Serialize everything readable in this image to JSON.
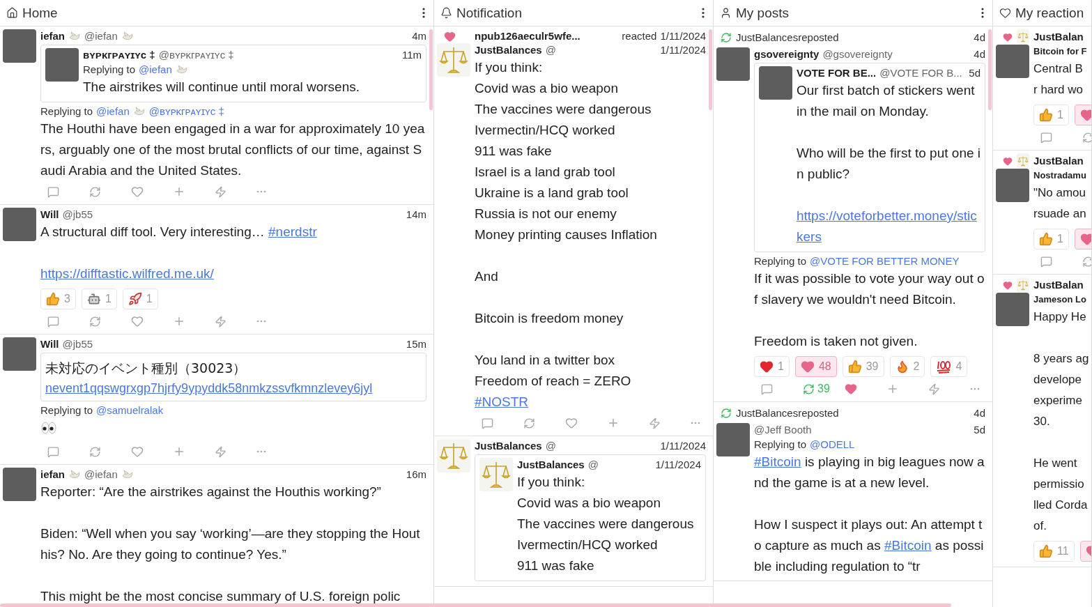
{
  "columns": [
    {
      "title": "Home",
      "kind": "home",
      "cut_off": false,
      "items": [
        {
          "post": {
            "avatar": {
              "kind": "photo"
            },
            "author": {
              "name": "iefan",
              "name_badge": true,
              "handle": "@iefan",
              "handle_badge": true
            },
            "time": "4m",
            "quote": {
              "avatar": {
                "kind": "photo"
              },
              "author": {
                "name": "ʙʏᴘᴋᴦᴘᴀʏɪʏᴄ ‡",
                "handle": "@ʙʏᴘᴋᴦᴘᴀʏɪʏᴄ ‡"
              },
              "time": "11m",
              "replying_to": {
                "label": "Replying to",
                "mentions": [
                  {
                    "text": "@iefan",
                    "badge": true
                  }
                ]
              },
              "body": [
                [
                  {
                    "kind": "text",
                    "text": "The airstrikes will continue until moral worsens."
                  }
                ]
              ]
            },
            "replying_to": {
              "label": "Replying to",
              "mentions": [
                {
                  "text": "@iefan",
                  "badge": true
                },
                {
                  "text": "@ʙʏᴘᴋᴦᴘᴀʏɪʏᴄ ‡"
                }
              ]
            },
            "body": [
              [
                {
                  "kind": "text",
                  "text": "The Houthi have been engaged in a war for approximately 10 years, arguably one of the most brutal conflicts of our time, against Saudi Arabia and the United States."
                }
              ]
            ],
            "actions": {
              "reposted": false,
              "liked": false
            }
          }
        },
        {
          "post": {
            "avatar": {
              "kind": "photo"
            },
            "author": {
              "name": "Will",
              "handle": "@jb55"
            },
            "time": "14m",
            "body": [
              [
                {
                  "kind": "mixed",
                  "parts": [
                    {
                      "kind": "text",
                      "text": "A structural diff tool. Very interesting… "
                    },
                    {
                      "kind": "link",
                      "text": "#nerdstr"
                    }
                  ]
                }
              ],
              [
                {
                  "kind": "link",
                  "text": "https://difftastic.wilfred.me.uk/"
                }
              ]
            ],
            "reactions": [
              {
                "kind": "thumbs_up",
                "count": "3",
                "selected": false
              },
              {
                "kind": "robot",
                "count": "1",
                "selected": false
              },
              {
                "kind": "rocket",
                "count": "1",
                "selected": false
              }
            ],
            "actions": {
              "reposted": false,
              "liked": false
            }
          }
        },
        {
          "post": {
            "avatar": {
              "kind": "photo"
            },
            "author": {
              "name": "Will",
              "handle": "@jb55"
            },
            "time": "15m",
            "embed": {
              "text": "未対応のイベント種別（30023）",
              "link": "nevent1qqswgrxgp7hjrfy9ypyddk58nmkzssvfkmnzlevey6jyl"
            },
            "replying_to": {
              "label": "Replying to",
              "mentions": [
                {
                  "text": "@samuelralak"
                }
              ]
            },
            "body": [
              [
                {
                  "kind": "eyes"
                }
              ]
            ],
            "actions": {
              "reposted": false,
              "liked": false
            }
          }
        },
        {
          "post": {
            "avatar": {
              "kind": "photo"
            },
            "author": {
              "name": "iefan",
              "name_badge": true,
              "handle": "@iefan",
              "handle_badge": true
            },
            "time": "16m",
            "body": [
              [
                {
                  "kind": "text",
                  "text": "Reporter: “Are the airstrikes against the Houthis working?”"
                }
              ],
              [
                {
                  "kind": "text",
                  "text": "Biden: “Well when you say ‘working’—are they stopping the Houthis? No. Are they going to continue? Yes.”"
                }
              ],
              [
                {
                  "kind": "text",
                  "text": "This might be the most concise summary of U.S. foreign polic"
                }
              ]
            ]
          }
        }
      ]
    },
    {
      "title": "Notification",
      "kind": "notification",
      "cut_off": false,
      "items": [
        {
          "header": {
            "kind": "reaction",
            "actor": "npub126aeculr5wfe...",
            "verb": "reacted",
            "time": "1/11/2024"
          },
          "post": {
            "avatar": {
              "kind": "scales"
            },
            "author": {
              "name": "JustBalances",
              "handle": "@"
            },
            "time": "1/11/2024",
            "body": [
              [
                {
                  "kind": "text",
                  "text": "If you think:"
                },
                {
                  "kind": "text",
                  "text": "Covid was a bio weapon"
                },
                {
                  "kind": "text",
                  "text": "The vaccines were dangerous"
                },
                {
                  "kind": "text",
                  "text": "Ivermectin/HCQ worked"
                },
                {
                  "kind": "text",
                  "text": "911 was fake"
                },
                {
                  "kind": "text",
                  "text": "Israel is a land grab tool"
                },
                {
                  "kind": "text",
                  "text": "Ukraine is a land grab tool"
                },
                {
                  "kind": "text",
                  "text": "Russia is not our enemy"
                },
                {
                  "kind": "text",
                  "text": "Money printing causes Inflation"
                }
              ],
              [
                {
                  "kind": "text",
                  "text": "And"
                }
              ],
              [
                {
                  "kind": "text",
                  "text": "Bitcoin is freedom money"
                }
              ],
              [
                {
                  "kind": "text",
                  "text": "You land in a twitter box"
                },
                {
                  "kind": "text",
                  "text": "Freedom of reach = ZERO"
                },
                {
                  "kind": "link",
                  "text": "#NOSTR"
                }
              ]
            ],
            "actions": {
              "reposted": false,
              "liked": false
            }
          }
        },
        {
          "post": {
            "avatar": {
              "kind": "scales"
            },
            "author": {
              "name": "JustBalances",
              "handle": "@"
            },
            "time": "1/11/2024",
            "quote": {
              "avatar": {
                "kind": "scales"
              },
              "author": {
                "name": "JustBalances",
                "handle": "@"
              },
              "time": "1/11/2024",
              "body": [
                [
                  {
                    "kind": "text",
                    "text": "If you think:"
                  },
                  {
                    "kind": "text",
                    "text": "Covid was a bio weapon"
                  },
                  {
                    "kind": "text",
                    "text": "The vaccines were dangerous"
                  },
                  {
                    "kind": "text",
                    "text": "Ivermectin/HCQ worked"
                  },
                  {
                    "kind": "text",
                    "text": "911 was fake"
                  }
                ]
              ]
            }
          }
        }
      ]
    },
    {
      "title": "My posts",
      "kind": "profile",
      "cut_off": false,
      "items": [
        {
          "header": {
            "kind": "repost",
            "text": "JustBalancesreposted",
            "time": "4d"
          },
          "post": {
            "avatar": {
              "kind": "photo"
            },
            "author": {
              "name": "gsovereignty",
              "handle": "@gsovereignty"
            },
            "time": "4d",
            "quote": {
              "avatar": {
                "kind": "photo"
              },
              "author": {
                "name": "VOTE FOR BE...",
                "handle": "@VOTE FOR B..."
              },
              "time": "5d",
              "body": [
                [
                  {
                    "kind": "text",
                    "text": "Our first batch of stickers went in the mail on Monday."
                  }
                ],
                [
                  {
                    "kind": "text",
                    "text": "Who will be the first to put one in public?"
                  }
                ],
                [
                  {
                    "kind": "link",
                    "text": "https://voteforbetter.money/stickers"
                  }
                ]
              ]
            },
            "replying_to": {
              "label": "Replying to",
              "mentions": [
                {
                  "text": "@VOTE FOR BETTER MONEY"
                }
              ]
            },
            "body": [
              [
                {
                  "kind": "text",
                  "text": "If it was possible to vote your way out of slavery we wouldn't need Bitcoin."
                }
              ],
              [
                {
                  "kind": "text",
                  "text": "Freedom is taken not given."
                }
              ]
            ],
            "reactions": [
              {
                "kind": "red_heart",
                "count": "1",
                "selected": false
              },
              {
                "kind": "pink_heart",
                "count": "48",
                "selected": true
              },
              {
                "kind": "thumbs_up",
                "count": "39",
                "selected": false
              },
              {
                "kind": "fire",
                "count": "2",
                "selected": false
              },
              {
                "kind": "hundred",
                "count": "4",
                "selected": false
              }
            ],
            "actions": {
              "reposted": true,
              "repost_count": "39",
              "liked": true
            }
          }
        },
        {
          "header": {
            "kind": "repost",
            "text": "JustBalancesreposted",
            "time": "4d"
          },
          "post": {
            "avatar": {
              "kind": "photo"
            },
            "author": {
              "handle": "@Jeff Booth"
            },
            "time": "5d",
            "replying_to": {
              "label": "Replying to",
              "mentions": [
                {
                  "text": "@ODELL"
                }
              ]
            },
            "body": [
              [
                {
                  "kind": "mixed",
                  "parts": [
                    {
                      "kind": "link",
                      "text": "#Bitcoin"
                    },
                    {
                      "kind": "text",
                      "text": " is playing in big leagues now and the game is at a new level."
                    }
                  ]
                }
              ],
              [
                {
                  "kind": "mixed",
                  "parts": [
                    {
                      "kind": "text",
                      "text": "How I suspect it plays out: An attempt to capture as much as "
                    },
                    {
                      "kind": "link",
                      "text": "#Bitcoin"
                    },
                    {
                      "kind": "text",
                      "text": " as possible including regulation to “tr"
                    }
                  ]
                }
              ]
            ]
          }
        }
      ]
    },
    {
      "title": "My reaction",
      "kind": "reactions",
      "cut_off": true,
      "items": [
        {
          "header": {
            "kind": "reaction",
            "actor": "JustBalan",
            "avatar": {
              "kind": "scales"
            }
          },
          "post": {
            "avatar": {
              "kind": "photo"
            },
            "author": {
              "name": "Bitcoin for F"
            },
            "body": [
              [
                {
                  "kind": "text",
                  "text": "Central B"
                },
                {
                  "kind": "text",
                  "text": "r hard wo"
                }
              ]
            ],
            "reactions": [
              {
                "kind": "thumbs_up",
                "count": "1",
                "selected": false
              },
              {
                "kind": "pink_heart",
                "selected": true
              }
            ],
            "actions": {
              "reposted": false
            }
          }
        },
        {
          "header": {
            "kind": "reaction",
            "actor": "JustBalan",
            "avatar": {
              "kind": "scales"
            }
          },
          "post": {
            "avatar": {
              "kind": "photo"
            },
            "author": {
              "name": "Nostradamu"
            },
            "body": [
              [
                {
                  "kind": "text",
                  "text": "\"No amou"
                },
                {
                  "kind": "text",
                  "text": "rsuade an"
                }
              ]
            ],
            "reactions": [
              {
                "kind": "thumbs_up",
                "count": "1",
                "selected": false
              },
              {
                "kind": "pink_heart",
                "selected": true
              }
            ],
            "actions": {
              "reposted": false
            }
          }
        },
        {
          "header": {
            "kind": "reaction",
            "actor": "JustBalan",
            "avatar": {
              "kind": "scales"
            }
          },
          "post": {
            "avatar": {
              "kind": "photo"
            },
            "author": {
              "name": "Jameson Lo"
            },
            "body": [
              [
                {
                  "kind": "text",
                  "text": "Happy He"
                }
              ],
              [
                {
                  "kind": "text",
                  "text": "8 years ag"
                },
                {
                  "kind": "text",
                  "text": "develope"
                },
                {
                  "kind": "text",
                  "text": "experime"
                },
                {
                  "kind": "text",
                  "text": "30."
                }
              ],
              [
                {
                  "kind": "text",
                  "text": "He went"
                },
                {
                  "kind": "text",
                  "text": "permissio"
                },
                {
                  "kind": "text",
                  "text": "lled Corda"
                },
                {
                  "kind": "text",
                  "text": "of."
                }
              ]
            ],
            "reactions": [
              {
                "kind": "thumbs_up",
                "count": "11",
                "selected": false
              },
              {
                "kind": "pink_heart",
                "selected": true
              }
            ]
          }
        }
      ]
    }
  ]
}
